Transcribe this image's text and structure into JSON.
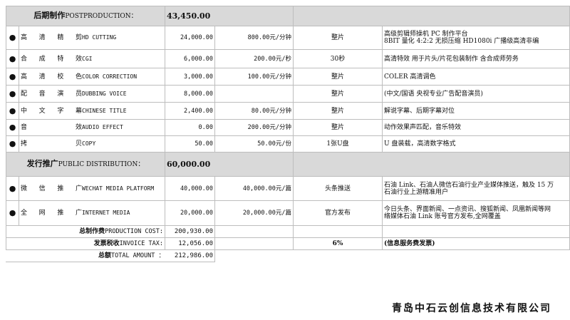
{
  "sections": [
    {
      "label_cn": "后期制作",
      "label_en": "POSTPRODUCTION：",
      "amount": "43,450.00",
      "items": [
        {
          "cn": "高清精剪",
          "en": "HD CUTTING",
          "amount": "24,000.00",
          "price": "800.00元/分钟",
          "unit": "整片",
          "note_lines": [
            "高级剪辑师操机 PC 制作平台",
            "8BIT 量化 4:2:2 无损压缩 HD1080i 广播级高清非编"
          ]
        },
        {
          "cn": "合成特效",
          "en": "CGI",
          "amount": "6,000.00",
          "price": "200.00元/秒",
          "unit": "30秒",
          "note_lines": [
            "高清特效 用于片头/片花包装制作  含合成师劳务"
          ]
        },
        {
          "cn": "高清校色",
          "en": "COLOR CORRECTION",
          "amount": "3,000.00",
          "price": "100.00元/分钟",
          "unit": "整片",
          "note_lines": [
            "COLER 高清调色"
          ]
        },
        {
          "cn": "配音演员",
          "en": "DUBBING VOICE",
          "amount": "8,000.00",
          "price": "",
          "unit": "整片",
          "note_lines": [
            "(中文/国语 央视专业广告配音演员)"
          ]
        },
        {
          "cn": "中文字幕",
          "en": "CHINESE TITLE",
          "amount": "2,400.00",
          "price": "80.00元/分钟",
          "unit": "整片",
          "note_lines": [
            "解说字幕、后期字幕对位"
          ]
        },
        {
          "cn": "音效",
          "en": "AUDIO EFFECT",
          "amount": "0.00",
          "price": "200.00元/分钟",
          "unit": "整片",
          "note_lines": [
            "动作效果声匹配，音乐特效"
          ]
        },
        {
          "cn": "拷贝",
          "en": "COPY",
          "amount": "50.00",
          "price": "50.00元/份",
          "unit": "1张U盘",
          "note_lines": [
            "U 盘装载，高清数字格式"
          ]
        }
      ]
    },
    {
      "label_cn": "发行推广",
      "label_en": "PUBLIC DISTRIBUTION：",
      "amount": "60,000.00",
      "items": [
        {
          "cn": "微信推广",
          "en": "WECHAT MEDIA PLATFORM",
          "amount": "40,000.00",
          "price": "40,000.00元/篇",
          "unit": "头条推送",
          "note_lines": [
            "石油 Link、石油人微信石油行业产业媒体推送，触及 15 万",
            "石油行业上游精准用户"
          ]
        },
        {
          "cn": "全网推广",
          "en": "INTERNET MEDIA",
          "amount": "20,000.00",
          "price": "20,000.00元/篇",
          "unit": "官方发布",
          "note_lines": [
            "今日头条、界面新闻、一点资讯、搜狐新闻、凤凰新闻等网",
            "络媒体石油 Link 账号官方发布,全网覆盖"
          ]
        }
      ]
    }
  ],
  "totals": {
    "production_cost": {
      "cn": "总制作费",
      "en": "PRODUCTION COST:",
      "value": "200,930.00"
    },
    "invoice_tax": {
      "cn": "发票税收",
      "en": "INVOICE TAX:",
      "value": "12,056.00",
      "rate": "6%",
      "note": "(信息服务费发票)"
    },
    "total_amount": {
      "cn": "总额",
      "en": "TOTAL AMOUNT ：",
      "value": "212,986.00"
    }
  },
  "bullet": "●",
  "company": "青岛中石云创信息技术有限公司"
}
